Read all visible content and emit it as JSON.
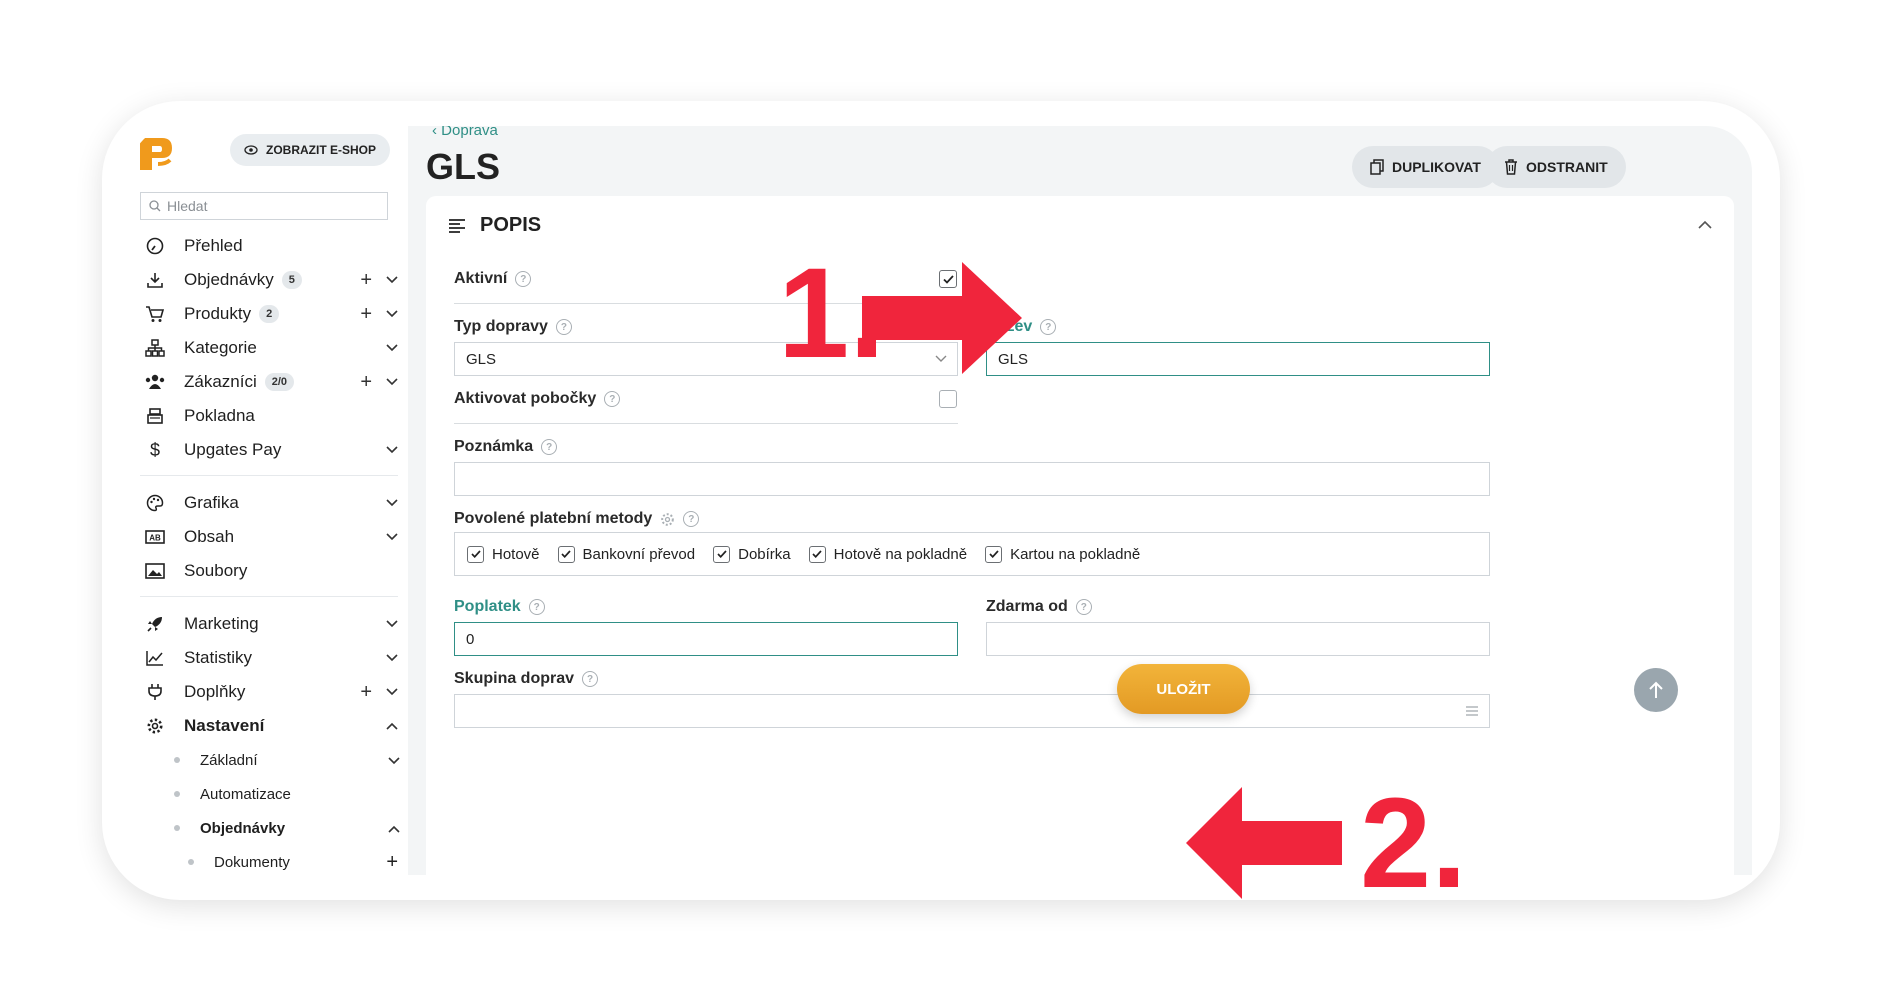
{
  "sidebar": {
    "eshop_button": "ZOBRAZIT E-SHOP",
    "search_placeholder": "Hledat",
    "items": [
      {
        "label": "Přehled",
        "icon": "gauge-icon"
      },
      {
        "label": "Objednávky",
        "icon": "download-icon",
        "badge": "5"
      },
      {
        "label": "Produkty",
        "icon": "cart-icon",
        "badge": "2"
      },
      {
        "label": "Kategorie",
        "icon": "sitemap-icon"
      },
      {
        "label": "Zákazníci",
        "icon": "users-icon",
        "badge": "2/0"
      },
      {
        "label": "Pokladna",
        "icon": "register-icon"
      },
      {
        "label": "Upgates Pay",
        "icon": "dollar-icon"
      },
      {
        "label": "Grafika",
        "icon": "palette-icon"
      },
      {
        "label": "Obsah",
        "icon": "ab-icon"
      },
      {
        "label": "Soubory",
        "icon": "image-icon"
      },
      {
        "label": "Marketing",
        "icon": "rocket-icon"
      },
      {
        "label": "Statistiky",
        "icon": "chart-icon"
      },
      {
        "label": "Doplňky",
        "icon": "plug-icon"
      },
      {
        "label": "Nastavení",
        "icon": "gear-icon"
      }
    ],
    "sub_items": [
      "Základní",
      "Automatizace",
      "Objednávky",
      "Dokumenty"
    ]
  },
  "header": {
    "breadcrumb": "Doprava",
    "title": "GLS",
    "duplicate_button": "DUPLIKOVAT",
    "delete_button": "ODSTRANIT"
  },
  "form": {
    "section_title": "POPIS",
    "active_label": "Aktivní",
    "active_checked": true,
    "shipping_type_label": "Typ dopravy",
    "shipping_type_value": "GLS",
    "name_label": "Název",
    "name_value": "GLS",
    "activate_branches_label": "Aktivovat pobočky",
    "activate_branches_checked": false,
    "note_label": "Poznámka",
    "payment_methods_label": "Povolené platební metody",
    "payment_methods": [
      "Hotově",
      "Bankovní převod",
      "Dobírka",
      "Hotově na pokladně",
      "Kartou na pokladně"
    ],
    "fee_label": "Poplatek",
    "fee_value": "0",
    "free_from_label": "Zdarma od",
    "group_label": "Skupina doprav",
    "save_button": "ULOŽIT"
  },
  "annotations": {
    "step1": "1.",
    "step2": "2.",
    "color": "#f0253c"
  },
  "colors": {
    "accent": "#2f8f86",
    "save": "#e8a12c",
    "logo": "#f09a1c"
  }
}
